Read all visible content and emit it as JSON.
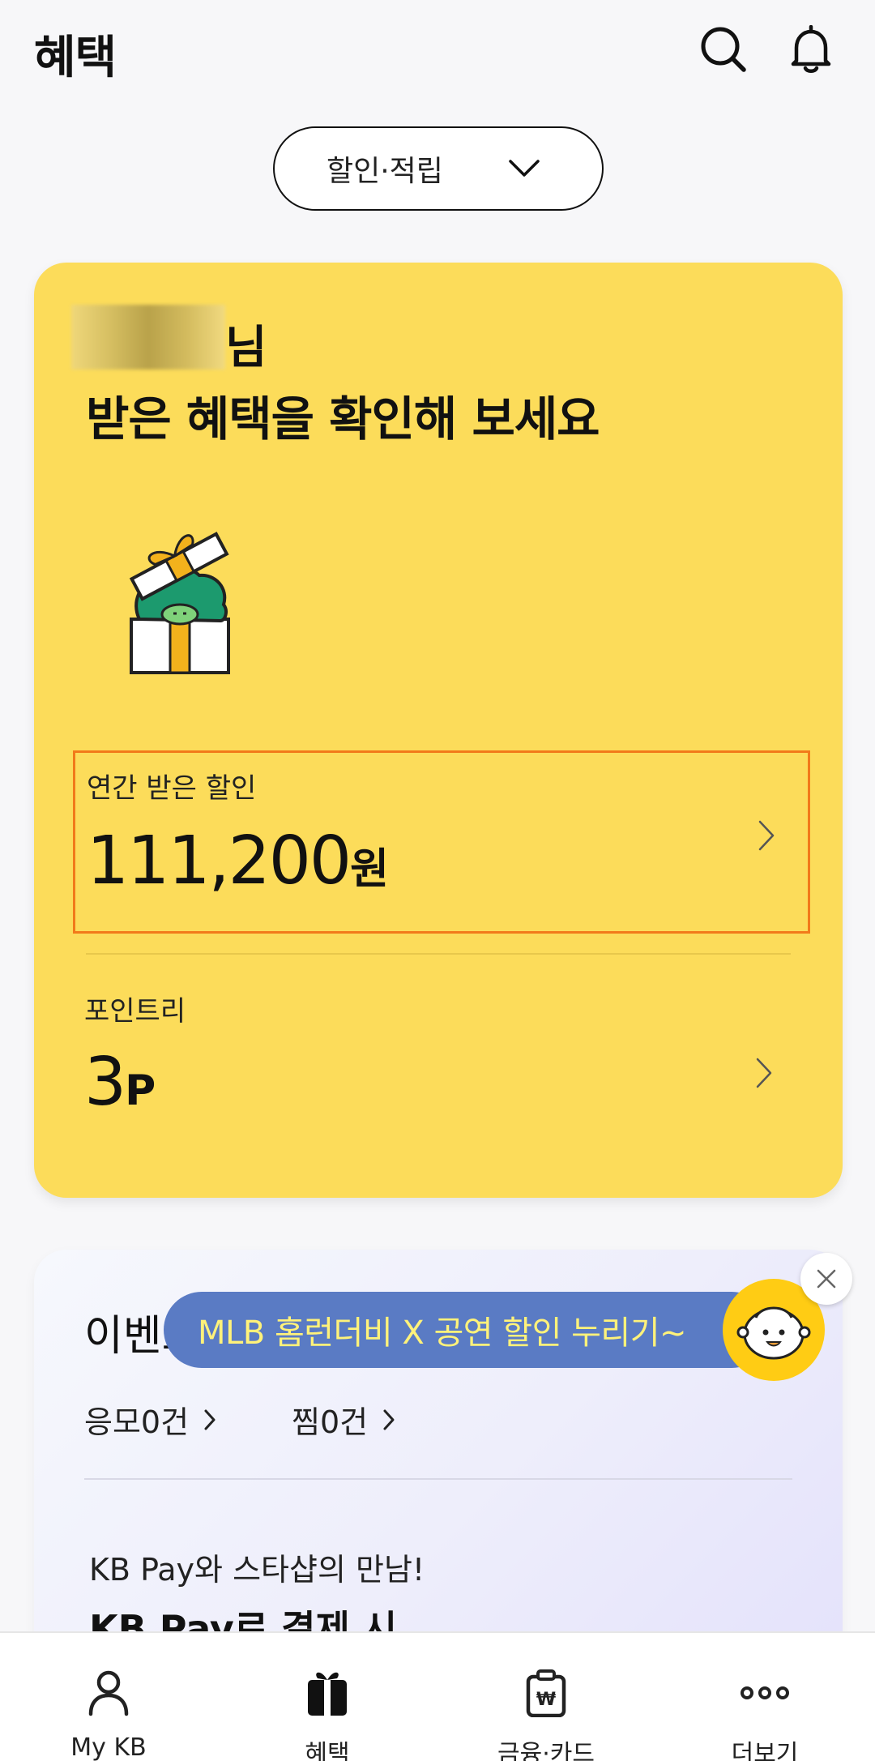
{
  "header": {
    "title": "혜택",
    "search_icon": "search-icon",
    "bell_icon": "bell-icon"
  },
  "filter": {
    "selected": "할인·적립",
    "icon": "chevron-down-icon"
  },
  "benefit_card": {
    "name_suffix": "님",
    "headline": "받은 혜택을 확인해 보세요",
    "discount": {
      "label": "연간 받은 할인",
      "amount": "111,200",
      "unit": "원"
    },
    "points": {
      "label": "포인트리",
      "amount": "3",
      "unit": "P"
    },
    "accent_color": "#fcdc5a",
    "highlight_color": "#f27a1a"
  },
  "event_card": {
    "title": "이벤트",
    "entries_label": "응모0건",
    "saved_label": "찜0건",
    "promo_line1": "KB Pay와 스타샵의 만남!",
    "promo_line2": "KB Pay로 결제 시"
  },
  "floating_banner": {
    "text": "MLB 홈런더비 X 공연 할인 누리기~",
    "background": "#5a7bc4",
    "text_color": "#fff27a"
  },
  "bottom_nav": {
    "items": [
      {
        "label": "My KB",
        "icon": "person-icon"
      },
      {
        "label": "혜택",
        "icon": "gift-icon"
      },
      {
        "label": "금융·카드",
        "icon": "wallet-won-icon"
      },
      {
        "label": "더보기",
        "icon": "more-dots-icon"
      }
    ],
    "active_index": 1
  }
}
